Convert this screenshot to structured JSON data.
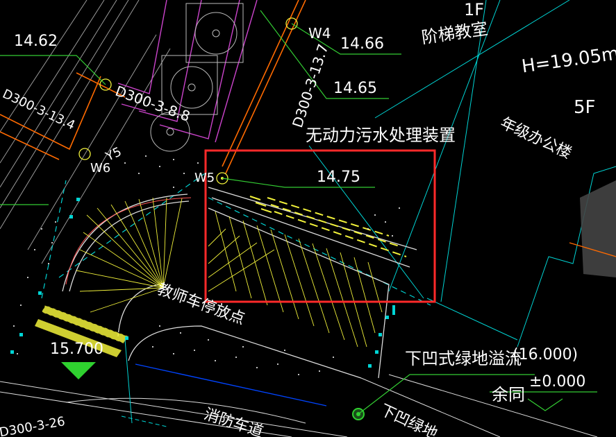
{
  "drawing": {
    "building": {
      "floor_1f": "1F",
      "room_label": "阶梯教室",
      "height_label": "H=19.05m",
      "floor_5f": "5F",
      "name": "年级办公楼"
    },
    "wells": [
      "W4",
      "W5",
      "W6",
      "Y5"
    ],
    "pipes": [
      "D300-3-13.7",
      "D300-3-8.8",
      "D300-3-13.4"
    ],
    "levels": [
      "14.62",
      "14.66",
      "14.65",
      "14.75",
      "15.700",
      "±0.000",
      "16.000"
    ],
    "labels": {
      "sewage_device": "无动力污水处理装置",
      "teacher_parking": "教师车停放点",
      "sunken_green_overflow": "下凹式绿地溢流",
      "overflow_level": "(16.000)",
      "same_below": "余同",
      "sunken_green_partial": "下凹绿地",
      "fire_lane_partial": "消防车道",
      "pipe_partial_bottom": "D300-3-26"
    },
    "highlight_color": "#ff2a2a",
    "colors": {
      "green_leader": "#33cc33",
      "cyan_line": "#00d5d5",
      "yellow_hatch": "#f2f23a",
      "orange_pipe": "#ff6a00",
      "magenta_wall": "#cc44cc",
      "white": "#ffffff"
    }
  }
}
